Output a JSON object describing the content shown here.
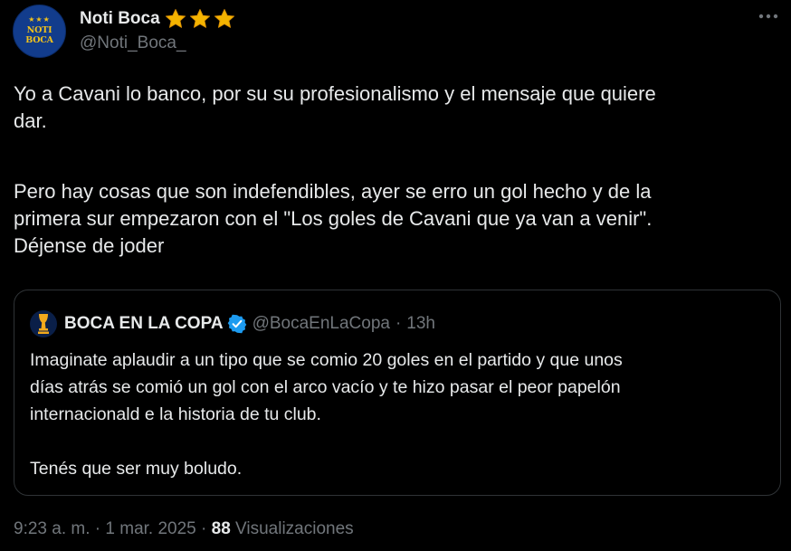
{
  "author": {
    "avatar_logo_text": "NOTI BOCA",
    "display_name": "Noti Boca",
    "name_badges": [
      "star-icon",
      "star-icon",
      "star-icon"
    ],
    "handle": "@Noti_Boca_"
  },
  "more_icon": "more-horizontal-icon",
  "tweet": {
    "paragraphs": [
      {
        "lines": [
          "Yo a Cavani lo banco, por su su profesionalismo y el mensaje que quiere",
          "dar."
        ]
      },
      {
        "lines": [
          "Pero hay cosas que son indefendibles, ayer se erro un gol hecho y de la",
          "primera sur empezaron con el \"Los goles de Cavani que ya van a venir\".",
          "Déjense de joder"
        ]
      }
    ]
  },
  "quote": {
    "display_name": "BOCA EN LA COPA",
    "verified_icon": "verified-badge-icon",
    "handle": "@BocaEnLaCopa",
    "separator": "·",
    "time": "13h",
    "paragraphs": [
      {
        "lines": [
          "Imaginate aplaudir a un tipo que se comio 20 goles en el partido y que unos",
          "días atrás se comió un gol con el arco vacío y te hizo pasar el peor papelón",
          "internacionald e la historia de tu club."
        ]
      },
      {
        "lines": [
          "Tenés que ser muy boludo."
        ]
      }
    ]
  },
  "meta": {
    "time": "9:23 a. m.",
    "separator": "·",
    "date": "1 mar. 2025",
    "views_count": "88",
    "views_label": "Visualizaciones"
  },
  "colors": {
    "background": "#000000",
    "text_primary": "#e7e9ea",
    "text_secondary": "#71767b",
    "border": "#2f3336",
    "verified_blue": "#1d9bf0",
    "star_gold": "#f4b400",
    "avatar_blue": "#123c8c"
  }
}
